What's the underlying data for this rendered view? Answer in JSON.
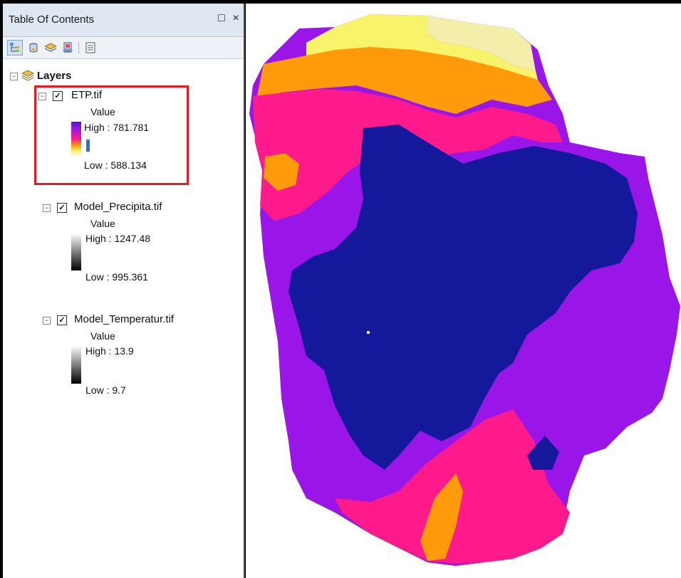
{
  "toc": {
    "title": "Table Of Contents",
    "window_buttons": [
      "□",
      "×"
    ],
    "toolbar_icons": [
      "list-by-drawing-order-icon",
      "list-by-source-icon",
      "list-by-visibility-icon",
      "list-by-selection-icon",
      "options-icon"
    ],
    "root": {
      "label": "Layers"
    },
    "layers": [
      {
        "name": "ETP.tif",
        "checked": true,
        "field": "Value",
        "high": "High : 781.781",
        "low": "Low : 588.134",
        "ramp": "magenta-yellow"
      },
      {
        "name": "Model_Precipita.tif",
        "checked": true,
        "field": "Value",
        "high": "High : 1247.48",
        "low": "Low : 995.361",
        "ramp": "white-black"
      },
      {
        "name": "Model_Temperatur.tif",
        "checked": true,
        "field": "Value",
        "high": "High : 13.9",
        "low": "Low : 9.7",
        "ramp": "white-black"
      }
    ]
  },
  "colors": {
    "highlight_box": "#e8191f",
    "class_darkblue": "#13199a",
    "class_purple": "#9a16e8",
    "class_magenta": "#ff1a8c",
    "class_orange": "#ff9a0a",
    "class_yellow": "#f7f36a",
    "class_paleyellow": "#f3efaa"
  }
}
